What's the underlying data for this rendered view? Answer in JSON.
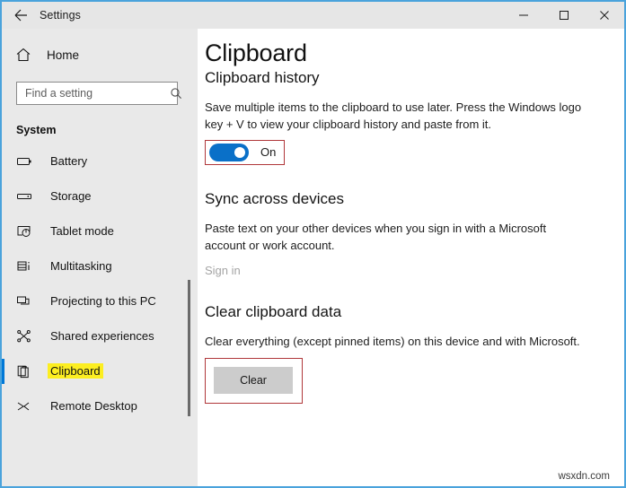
{
  "window": {
    "app_title": "Settings",
    "back_icon": "back-arrow-icon",
    "controls": {
      "minimize": "minimize-icon",
      "maximize": "maximize-icon",
      "close": "close-icon"
    },
    "border_color": "#4aa3dc"
  },
  "sidebar": {
    "home": {
      "label": "Home",
      "icon": "home-icon"
    },
    "search": {
      "value": "",
      "placeholder": "Find a setting",
      "icon": "search-icon"
    },
    "group_label": "System",
    "items": [
      {
        "label": "Battery",
        "icon": "battery-icon",
        "selected": false
      },
      {
        "label": "Storage",
        "icon": "storage-icon",
        "selected": false
      },
      {
        "label": "Tablet mode",
        "icon": "tablet-mode-icon",
        "selected": false
      },
      {
        "label": "Multitasking",
        "icon": "multitasking-icon",
        "selected": false
      },
      {
        "label": "Projecting to this PC",
        "icon": "projecting-icon",
        "selected": false
      },
      {
        "label": "Shared experiences",
        "icon": "shared-experiences-icon",
        "selected": false
      },
      {
        "label": "Clipboard",
        "icon": "clipboard-icon",
        "selected": true
      },
      {
        "label": "Remote Desktop",
        "icon": "remote-desktop-icon",
        "selected": false
      }
    ],
    "selected_highlight_color": "#fcee21",
    "accent_color": "#0078d7"
  },
  "main": {
    "page_title": "Clipboard",
    "sections": [
      {
        "heading": "Clipboard history",
        "description": "Save multiple items to the clipboard to use later. Press the Windows logo key + V to view your clipboard history and paste from it.",
        "toggle_state": "On",
        "toggle_on": true
      },
      {
        "heading": "Sync across devices",
        "description": "Paste text on your other devices when you sign in with a Microsoft account or work account.",
        "link_label": "Sign in"
      },
      {
        "heading": "Clear clipboard data",
        "description": "Clear everything (except pinned items) on this device and with Microsoft.",
        "button_label": "Clear"
      }
    ],
    "annotation_color": "#b0373a",
    "toggle_color": "#0a70c8"
  },
  "watermark": "wsxdn.com"
}
